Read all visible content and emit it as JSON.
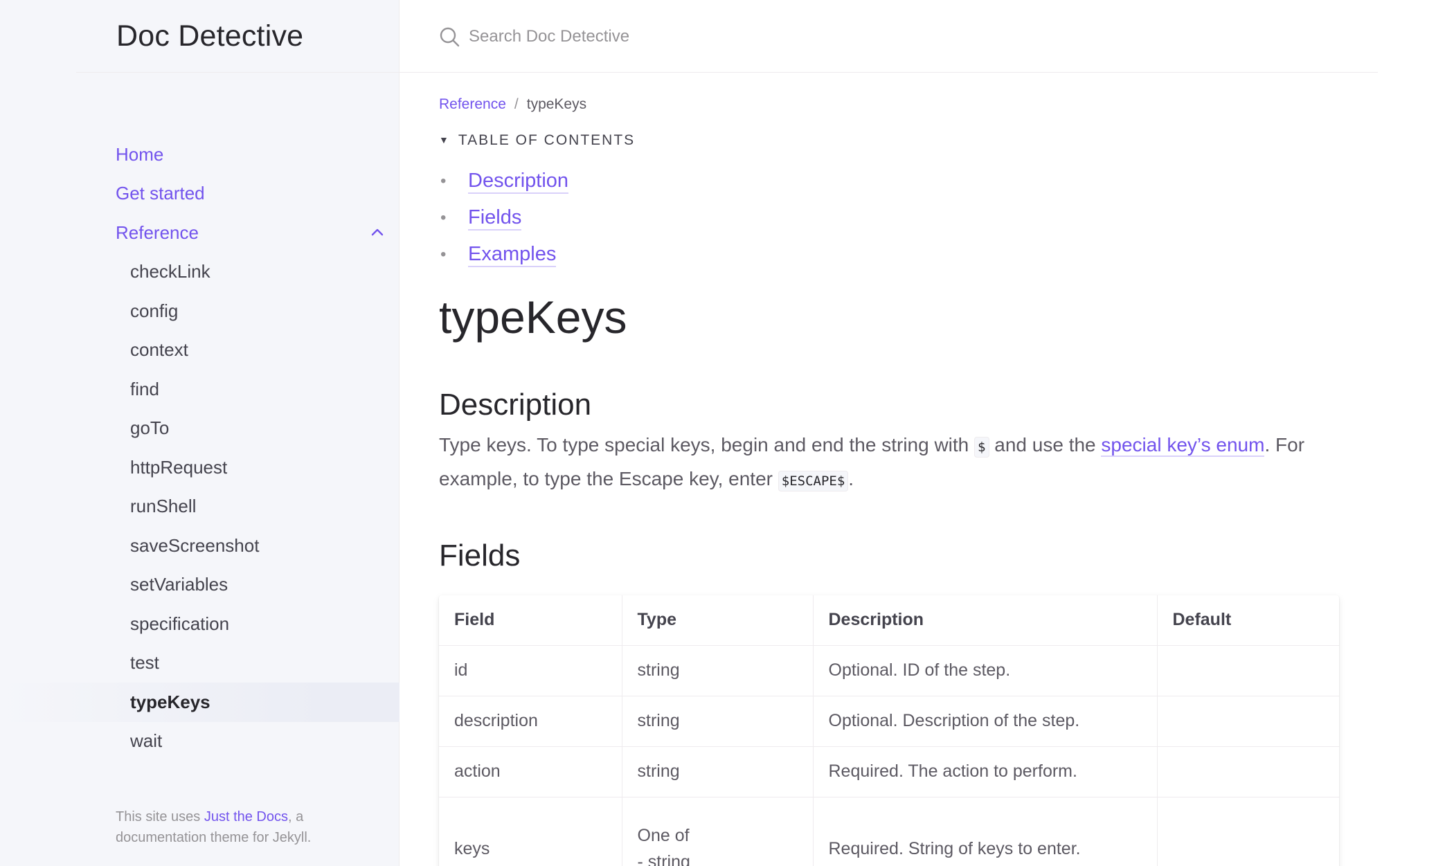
{
  "site": {
    "title": "Doc Detective"
  },
  "search": {
    "placeholder": "Search Doc Detective"
  },
  "sidebar": {
    "items": [
      {
        "label": "Home"
      },
      {
        "label": "Get started"
      },
      {
        "label": "Reference"
      }
    ],
    "reference_children": [
      {
        "label": "checkLink"
      },
      {
        "label": "config"
      },
      {
        "label": "context"
      },
      {
        "label": "find"
      },
      {
        "label": "goTo"
      },
      {
        "label": "httpRequest"
      },
      {
        "label": "runShell"
      },
      {
        "label": "saveScreenshot"
      },
      {
        "label": "setVariables"
      },
      {
        "label": "specification"
      },
      {
        "label": "test"
      },
      {
        "label": "typeKeys"
      },
      {
        "label": "wait"
      }
    ],
    "active_item": "typeKeys",
    "footer": {
      "prefix": "This site uses ",
      "link": "Just the Docs",
      "suffix": ", a documentation theme for Jekyll."
    }
  },
  "breadcrumb": {
    "parent": "Reference",
    "separator": "/",
    "current": "typeKeys"
  },
  "toc": {
    "summary": "TABLE OF CONTENTS",
    "items": [
      "Description",
      "Fields",
      "Examples"
    ]
  },
  "page": {
    "title": "typeKeys",
    "description_heading": "Description",
    "description": {
      "part1": "Type keys. To type special keys, begin and end the string with ",
      "code1": "$",
      "part2": " and use the ",
      "link": "special key’s enum",
      "part3": ". For example, to type the Escape key, enter ",
      "code2": "$ESCAPE$",
      "part4": "."
    },
    "fields_heading": "Fields"
  },
  "fields_table": {
    "headers": [
      "Field",
      "Type",
      "Description",
      "Default"
    ],
    "rows": [
      {
        "field": "id",
        "type": "string",
        "description": "Optional. ID of the step.",
        "default": ""
      },
      {
        "field": "description",
        "type": "string",
        "description": "Optional. Description of the step.",
        "default": ""
      },
      {
        "field": "action",
        "type": "string",
        "description": "Required. The action to perform.",
        "default": ""
      },
      {
        "field": "keys",
        "type_line1": "One of",
        "type_line2": "- string",
        "description": "Required. String of keys to enter.",
        "default": ""
      }
    ]
  },
  "colors": {
    "accent": "#7253ed",
    "sidebar_bg": "#f5f6fa",
    "heading": "#27262b"
  }
}
